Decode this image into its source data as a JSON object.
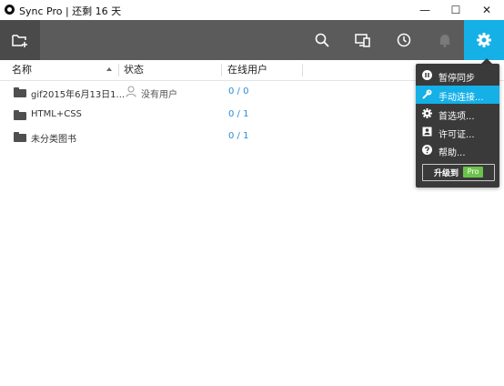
{
  "window": {
    "title": "Sync Pro | 还剩 16 天",
    "minimize": "—",
    "maximize": "☐",
    "close": "✕"
  },
  "toolbar": {
    "icons": [
      "add-folder-icon",
      "search-icon",
      "devices-icon",
      "history-icon",
      "bell-icon",
      "gear-icon"
    ],
    "accent": "#14b0e6"
  },
  "columns": {
    "name": "名称",
    "status": "状态",
    "online": "在线用户"
  },
  "rows": [
    {
      "name": "gif2015年6月13日1...",
      "status": "没有用户",
      "online": "0 / 0"
    },
    {
      "name": "HTML+CSS",
      "status": "",
      "online": "0 / 1"
    },
    {
      "name": "未分类图书",
      "status": "",
      "online": "0 / 1"
    }
  ],
  "menu": {
    "items": [
      {
        "label": "暂停同步",
        "icon": "pause-icon"
      },
      {
        "label": "手动连接...",
        "icon": "key-icon"
      },
      {
        "label": "首选项...",
        "icon": "gear-icon"
      },
      {
        "label": "许可证...",
        "icon": "license-icon"
      },
      {
        "label": "帮助...",
        "icon": "help-icon"
      }
    ],
    "upgrade": "升级到",
    "pro": "Pro"
  }
}
